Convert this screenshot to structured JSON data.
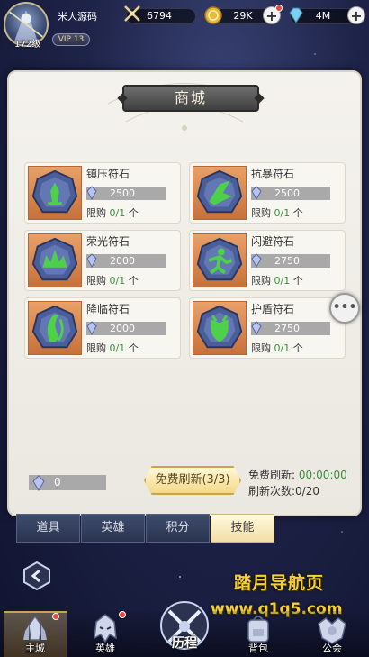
{
  "player": {
    "name": "米人源码",
    "level": "172级",
    "vip": "VIP 13"
  },
  "resources": {
    "power": "6794",
    "gold": "29K",
    "gems": "4M"
  },
  "shop": {
    "title": "商城",
    "items": [
      {
        "name": "镇压符石",
        "price": "2500",
        "limit_prefix": "限购 ",
        "limit_count": "0/1",
        "limit_suffix": " 个",
        "icon": "suppress-rune-icon"
      },
      {
        "name": "抗暴符石",
        "price": "2500",
        "limit_prefix": "限购 ",
        "limit_count": "0/1",
        "limit_suffix": " 个",
        "icon": "resist-crit-rune-icon"
      },
      {
        "name": "荣光符石",
        "price": "2000",
        "limit_prefix": "限购 ",
        "limit_count": "0/1",
        "limit_suffix": " 个",
        "icon": "glory-rune-icon"
      },
      {
        "name": "闪避符石",
        "price": "2750",
        "limit_prefix": "限购 ",
        "limit_count": "0/1",
        "limit_suffix": " 个",
        "icon": "dodge-rune-icon"
      },
      {
        "name": "降临符石",
        "price": "2000",
        "limit_prefix": "限购 ",
        "limit_count": "0/1",
        "limit_suffix": " 个",
        "icon": "descend-rune-icon"
      },
      {
        "name": "护盾符石",
        "price": "2750",
        "limit_prefix": "限购 ",
        "limit_count": "0/1",
        "limit_suffix": " 个",
        "icon": "shield-rune-icon"
      }
    ],
    "currency_amount": "0",
    "refresh_button": "免费刷新(3/3)",
    "free_refresh_label": "免费刷新: ",
    "free_refresh_timer": "00:00:00",
    "refresh_count": "刷新次数:0/20"
  },
  "tabs": [
    {
      "label": "道具",
      "active": false
    },
    {
      "label": "英雄",
      "active": false
    },
    {
      "label": "积分",
      "active": false
    },
    {
      "label": "技能",
      "active": true
    }
  ],
  "watermark": {
    "title": "踏月导航页",
    "url": "www.q1q5.com"
  },
  "nav": {
    "main_city": "主城",
    "heroes": "英雄",
    "journey": "历程",
    "bag": "背包",
    "guild": "公会"
  },
  "colors": {
    "accent_gold": "#c9a548",
    "limit_green": "#3a8f3a",
    "rune_blue": "#4a5e9a",
    "rune_green": "#4fd04a"
  }
}
